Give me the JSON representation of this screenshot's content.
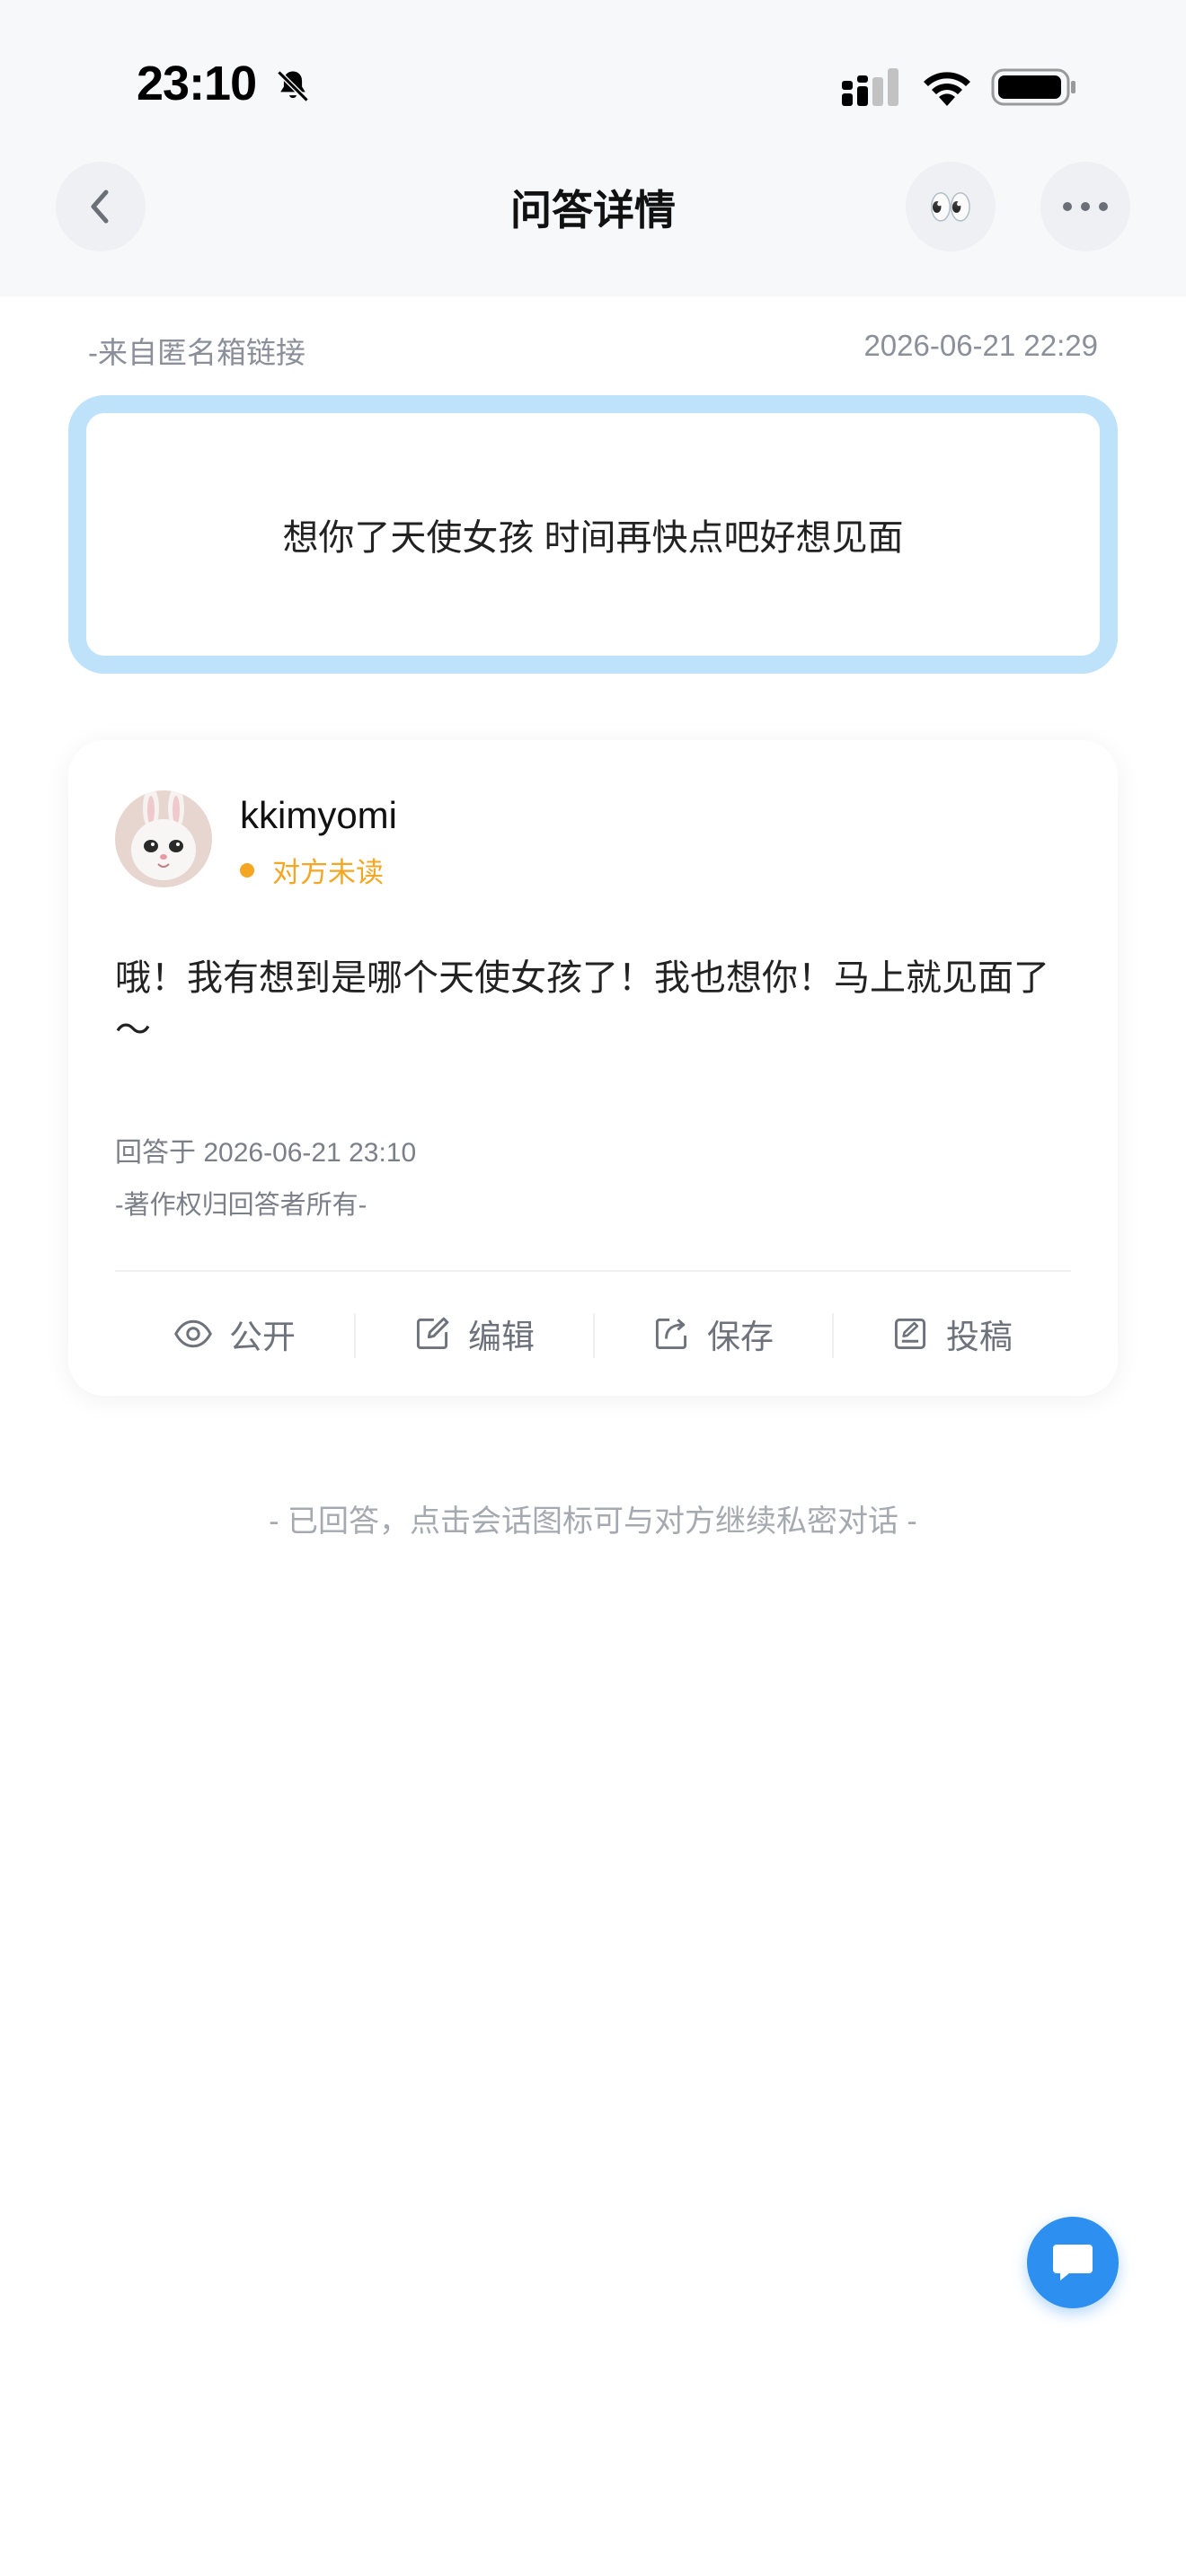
{
  "status_bar": {
    "time": "23:10"
  },
  "header": {
    "title": "问答详情",
    "eyes_emoji": "👀"
  },
  "question": {
    "source": "-来自匿名箱链接",
    "date": "2026-06-21 22:29",
    "text": "想你了天使女孩 时间再快点吧好想见面"
  },
  "answer": {
    "username": "kkimyomi",
    "read_status": "对方未读",
    "text": "哦！我有想到是哪个天使女孩了！我也想你！马上就见面了～",
    "answered_at": "回答于 2026-06-21 23:10",
    "copyright": "-著作权归回答者所有-",
    "actions": [
      {
        "label": "公开",
        "icon": "eye-icon"
      },
      {
        "label": "编辑",
        "icon": "edit-icon"
      },
      {
        "label": "保存",
        "icon": "share-icon"
      },
      {
        "label": "投稿",
        "icon": "submit-icon"
      }
    ]
  },
  "hint": "- 已回答，点击会话图标可与对方继续私密对话 -",
  "colors": {
    "accent": "#2d8ff0",
    "question_border": "#bfe2fb",
    "unread": "#f5a623",
    "background_top": "#f7f8fa"
  }
}
